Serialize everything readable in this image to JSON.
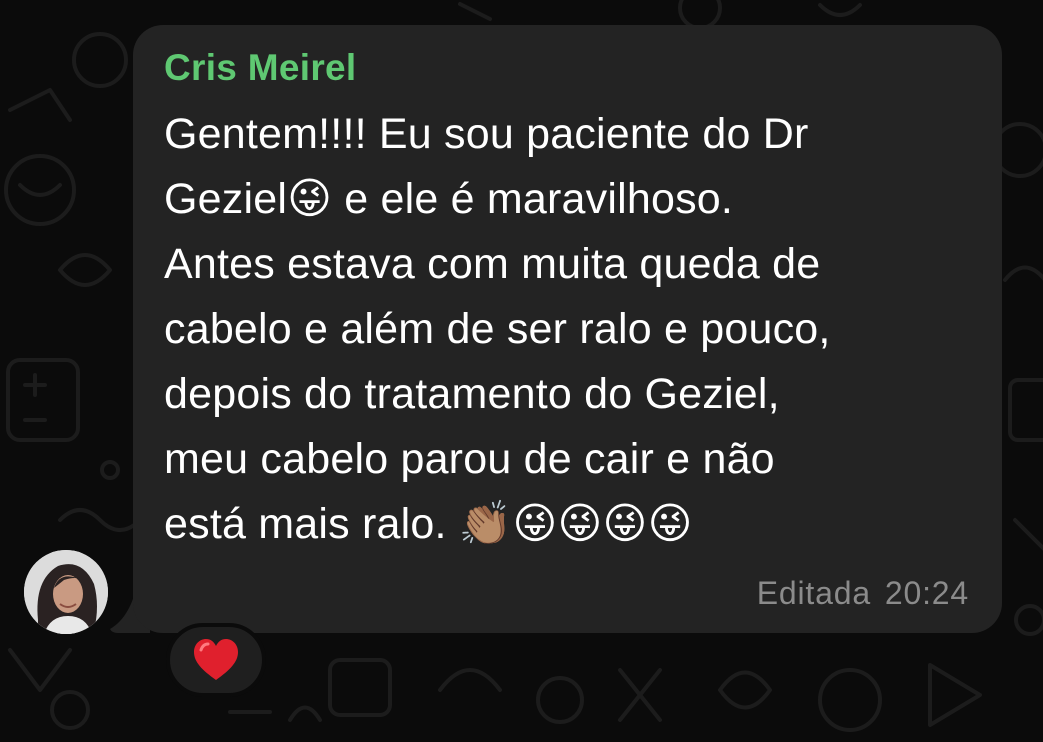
{
  "chat": {
    "sender_name": "Cris Meirel",
    "message_text": "Gentem!!!! Eu sou paciente do Dr\nGeziel😜 e ele é maravilhoso.\nAntes estava com muita queda de\ncabelo e além de ser ralo e pouco,\ndepois do  tratamento do Geziel,\nmeu cabelo parou de cair e não\nestá mais ralo. 👏🏽😜😜😜😜",
    "edited_label": "Editada",
    "time": "20:24",
    "reaction": "❤️"
  },
  "colors": {
    "bubble": "#232323",
    "sender": "#5fc872",
    "meta": "#8b8b8b",
    "background": "#0b0b0b"
  },
  "icons": {
    "avatar": "profile-photo",
    "reaction": "red-heart-icon"
  }
}
